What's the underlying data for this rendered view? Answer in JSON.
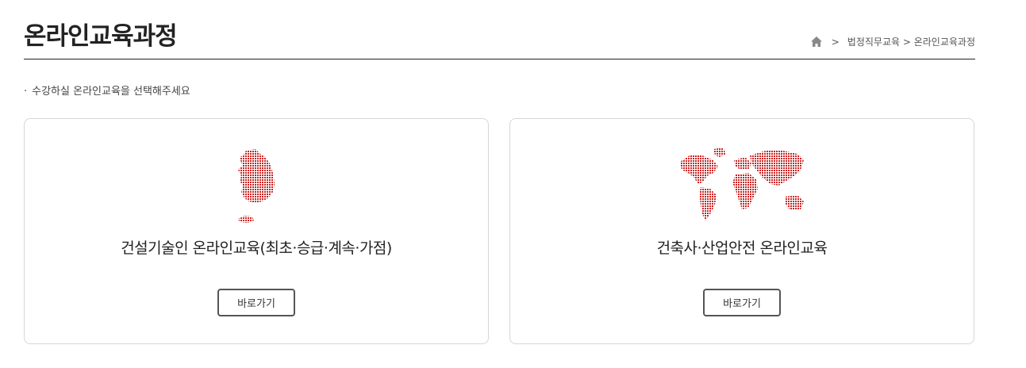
{
  "page": {
    "title": "온라인교육과정",
    "instruction": "수강하실 온라인교육을 선택해주세요",
    "bullet": "·"
  },
  "breadcrumb": {
    "separator": ">",
    "path": "법정직무교육 > 온라인교육과정"
  },
  "courses": [
    {
      "title": "건설기술인 온라인교육(최초·승급·계속·가점)",
      "button_label": "바로가기",
      "icon": "korea-map-icon"
    },
    {
      "title": "건축사·산업안전 온라인교육",
      "button_label": "바로가기",
      "icon": "world-map-icon"
    }
  ],
  "colors": {
    "map_red": "#cc2222",
    "border": "#d6d6d6"
  }
}
